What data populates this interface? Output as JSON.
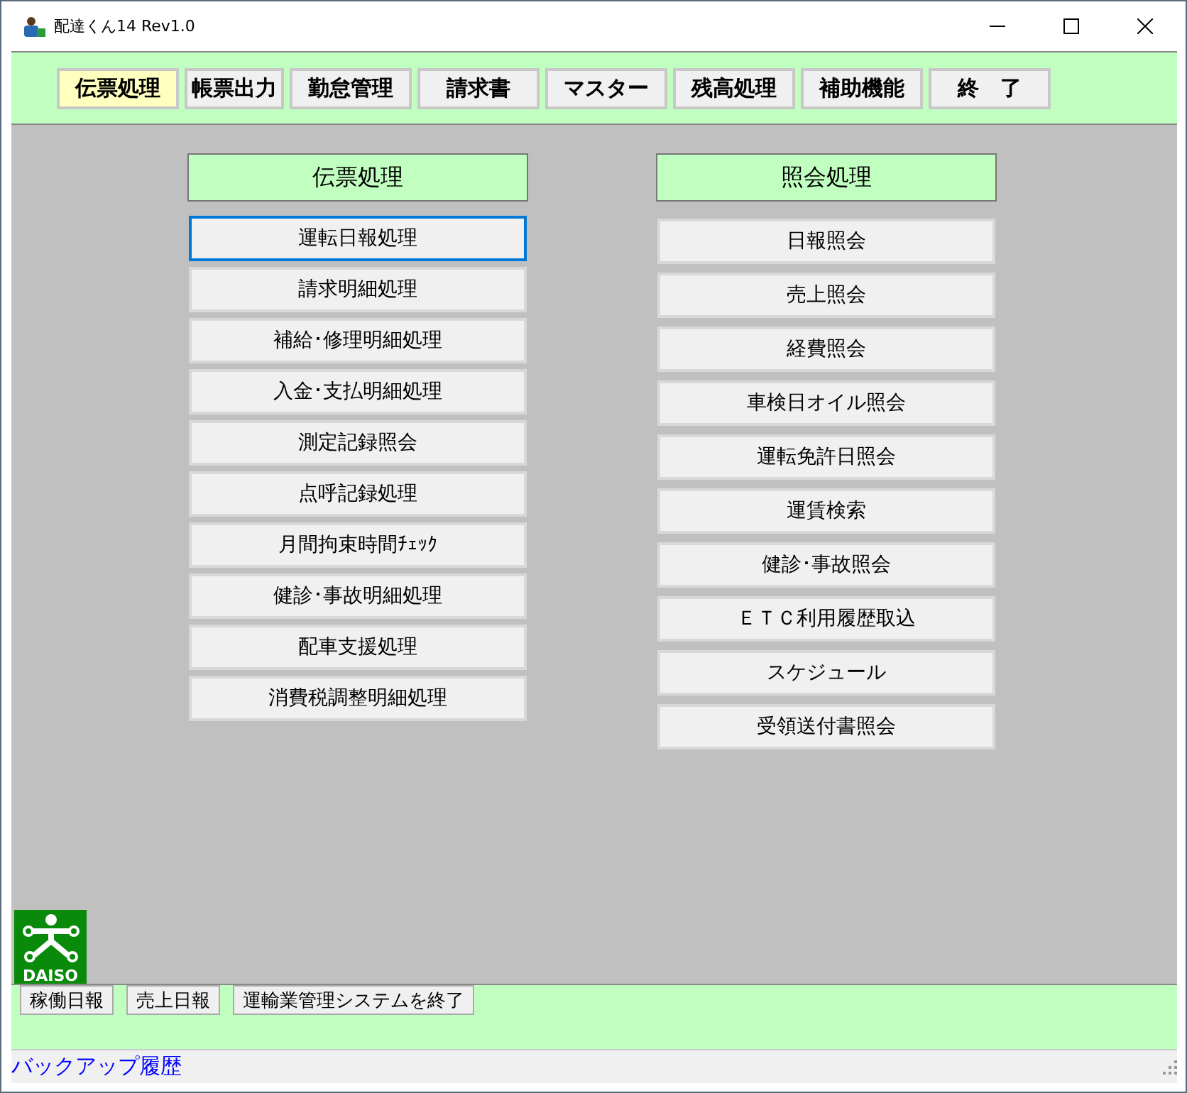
{
  "window": {
    "title": "配達くん14 Rev1.0"
  },
  "menu": [
    {
      "label": "伝票処理",
      "selected": true
    },
    {
      "label": "帳票出力",
      "selected": false
    },
    {
      "label": "勤怠管理",
      "selected": false
    },
    {
      "label": "請求書",
      "selected": false
    },
    {
      "label": "マスター",
      "selected": false
    },
    {
      "label": "残高処理",
      "selected": false
    },
    {
      "label": "補助機能",
      "selected": false
    },
    {
      "label": "終　了",
      "selected": false
    }
  ],
  "panels": [
    {
      "title": "伝票処理",
      "items": [
        {
          "label": "運転日報処理",
          "focused": true
        },
        {
          "label": "請求明細処理",
          "focused": false
        },
        {
          "label": "補給･修理明細処理",
          "focused": false
        },
        {
          "label": "入金･支払明細処理",
          "focused": false
        },
        {
          "label": "測定記録照会",
          "focused": false
        },
        {
          "label": "点呼記録処理",
          "focused": false
        },
        {
          "label": "月間拘束時間ﾁｪｯｸ",
          "focused": false
        },
        {
          "label": "健診･事故明細処理",
          "focused": false
        },
        {
          "label": "配車支援処理",
          "focused": false
        },
        {
          "label": "消費税調整明細処理",
          "focused": false
        }
      ]
    },
    {
      "title": "照会処理",
      "items": [
        {
          "label": "日報照会",
          "focused": false
        },
        {
          "label": "売上照会",
          "focused": false
        },
        {
          "label": "経費照会",
          "focused": false
        },
        {
          "label": "車検日オイル照会",
          "focused": false
        },
        {
          "label": "運転免許日照会",
          "focused": false
        },
        {
          "label": "運賃検索",
          "focused": false
        },
        {
          "label": "健診･事故照会",
          "focused": false
        },
        {
          "label": "ＥＴＣ利用履歴取込",
          "focused": false
        },
        {
          "label": "スケジュール",
          "focused": false
        },
        {
          "label": "受領送付書照会",
          "focused": false
        }
      ]
    }
  ],
  "logo": {
    "text": "DAISO"
  },
  "bottom_buttons": [
    "稼働日報",
    "売上日報",
    "運輸業管理システムを終了"
  ],
  "status_bar": {
    "link": "バックアップ履歴"
  }
}
